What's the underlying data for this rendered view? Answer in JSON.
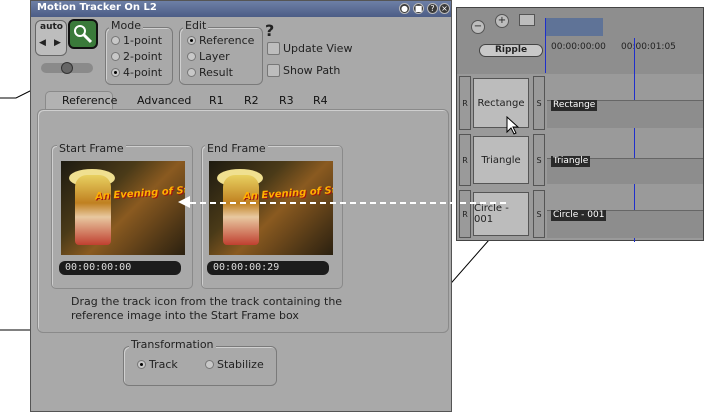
{
  "window": {
    "title": "Motion Tracker On L2",
    "title_buttons": [
      "●",
      "■",
      "?",
      "×"
    ]
  },
  "toolbar": {
    "auto_label": "auto",
    "left_arrow": "◀",
    "right_arrow": "▶"
  },
  "mode": {
    "label": "Mode",
    "options": [
      "1-point",
      "2-point",
      "4-point"
    ],
    "selected": "4-point"
  },
  "edit": {
    "label": "Edit",
    "options": [
      "Reference",
      "Layer",
      "Result"
    ],
    "selected": "Reference"
  },
  "help_icon": "?",
  "checkboxes": {
    "update_view": "Update View",
    "show_path": "Show Path"
  },
  "tabs": [
    "Reference",
    "Advanced",
    "R1",
    "R2",
    "R3",
    "R4"
  ],
  "active_tab": "Reference",
  "start_frame": {
    "label": "Start Frame",
    "timecode": "00:00:00:00",
    "overlay_text": "An Evening of Stardust"
  },
  "end_frame": {
    "label": "End Frame",
    "timecode": "00:00:00:29",
    "overlay_text": "An Evening of Stardust"
  },
  "instructions": "Drag the track icon from the track containing the\nreference image into the Start Frame box",
  "transformation": {
    "label": "Transformation",
    "options": [
      "Track",
      "Stabilize"
    ],
    "selected": "Track"
  },
  "timeline": {
    "ripple_label": "Ripple",
    "timecodes": [
      "00:00:00:00",
      "00:00:01:05"
    ],
    "tracks": [
      {
        "r": "R",
        "name": "Rectange",
        "s": "S",
        "clip": "Rectange"
      },
      {
        "r": "R",
        "name": "Triangle",
        "s": "S",
        "clip": "Triangle"
      },
      {
        "r": "R",
        "name": "Circle - 001",
        "s": "S",
        "clip": "Circle - 001"
      }
    ]
  },
  "colors": {
    "window_bg": "#a9a9a9",
    "titlebar": "#56678e",
    "playhead": "#1f2fcc"
  }
}
